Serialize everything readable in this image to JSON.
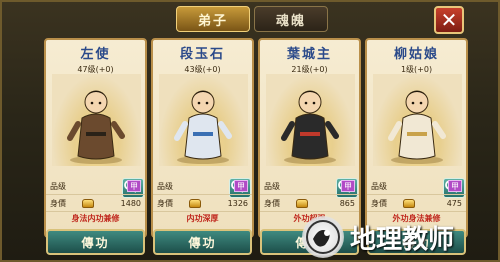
{
  "tabs": [
    {
      "label": "弟子",
      "active": true
    },
    {
      "label": "魂魄",
      "active": false
    }
  ],
  "close_label": "✕",
  "cards": [
    {
      "name": "左使",
      "level": "47级(+0)",
      "grade_label": "品级",
      "grade": "甲",
      "price_label": "身價",
      "price": "1480",
      "skill": "身法内功兼修",
      "button": "傳功",
      "robe": "#6b4a2e",
      "accent": "#2a2218"
    },
    {
      "name": "段玉石",
      "level": "43级(+0)",
      "grade_label": "品级",
      "grade": "甲",
      "price_label": "身價",
      "price": "1326",
      "skill": "内功深厚",
      "button": "傳功",
      "robe": "#dfe6ef",
      "accent": "#3a6fb3"
    },
    {
      "name": "葉城主",
      "level": "21级(+0)",
      "grade_label": "品级",
      "grade": "甲",
      "price_label": "身價",
      "price": "865",
      "skill": "外功超强",
      "button": "傳功",
      "robe": "#2a2a2a",
      "accent": "#c0392b"
    },
    {
      "name": "柳姑娘",
      "level": "1级(+0)",
      "grade_label": "品级",
      "grade": "甲",
      "price_label": "身價",
      "price": "475",
      "skill": "外功身法兼修",
      "button": "傳功",
      "robe": "#f1e8d4",
      "accent": "#c9a24a"
    }
  ],
  "watermark": {
    "text": "地理教师"
  }
}
